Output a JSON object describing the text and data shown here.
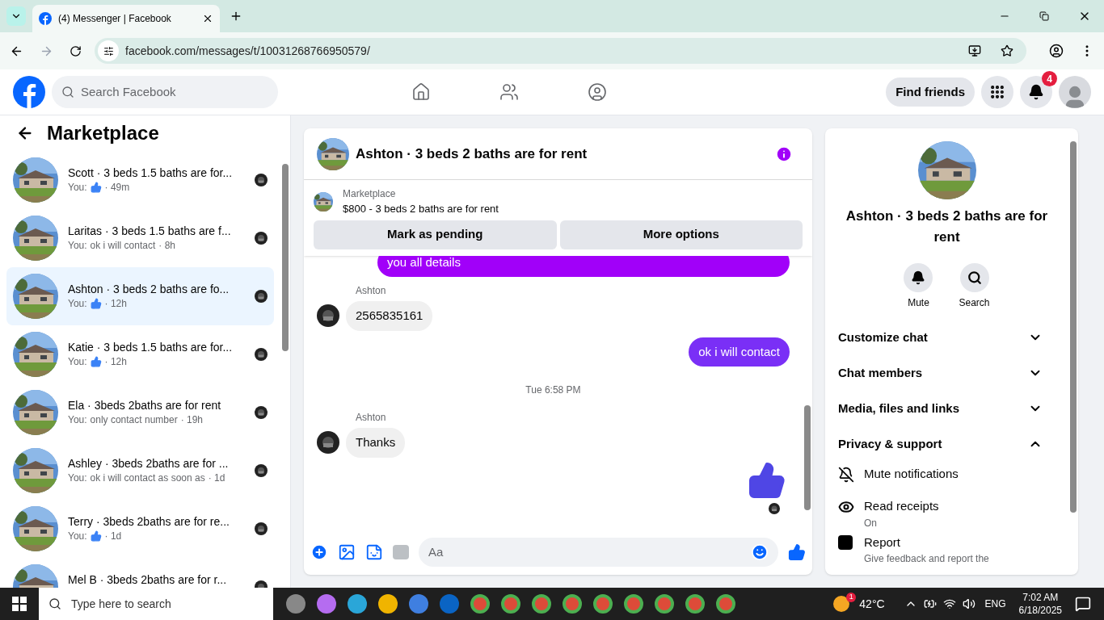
{
  "browser": {
    "tab_title": "(4) Messenger | Facebook",
    "url": "facebook.com/messages/t/10031268766950579/"
  },
  "topbar": {
    "search_placeholder": "Search Facebook",
    "find_friends": "Find friends",
    "notification_count": "4"
  },
  "sidebar": {
    "title": "Marketplace",
    "conversations": [
      {
        "title": "Scott · 3 beds 1.5 baths are for...",
        "sender": "You:",
        "like": true,
        "time": "· 49m",
        "selected": false
      },
      {
        "title": "Laritas · 3 beds 1.5 baths are f...",
        "sender": "You:",
        "like": false,
        "text": "ok i will contact",
        "time": "· 8h",
        "selected": false
      },
      {
        "title": "Ashton · 3 beds 2 baths are fo...",
        "sender": "You:",
        "like": true,
        "time": "· 12h",
        "selected": true
      },
      {
        "title": "Katie · 3 beds 1.5 baths are for...",
        "sender": "You:",
        "like": true,
        "time": "· 12h",
        "selected": false
      },
      {
        "title": "Ela · 3beds 2baths are for rent",
        "sender": "You:",
        "like": false,
        "text": "only contact number",
        "time": "· 19h",
        "selected": false
      },
      {
        "title": "Ashley · 3beds 2baths are for ...",
        "sender": "You:",
        "like": false,
        "text": "ok i will contact as soon as",
        "time": "· 1d",
        "selected": false
      },
      {
        "title": "Terry · 3beds 2baths are for re...",
        "sender": "You:",
        "like": true,
        "time": "· 1d",
        "selected": false
      },
      {
        "title": "Mel B · 3beds 2baths are for r...",
        "selected": false
      }
    ]
  },
  "chat": {
    "title": "Ashton · 3 beds 2 baths are for rent",
    "listing": {
      "source": "Marketplace",
      "summary": "$800 - 3 beds 2 baths are for rent",
      "buttons": [
        "Mark as pending",
        "More options"
      ]
    },
    "messages": [
      {
        "kind": "outgoing",
        "text": "you all details",
        "color": "#a100f9"
      },
      {
        "kind": "incoming",
        "sender": "Ashton",
        "text": "2565835161"
      },
      {
        "kind": "outgoing",
        "text": "ok i will contact",
        "color": "#7a2ff6"
      },
      {
        "kind": "timestamp",
        "text": "Tue 6:58 PM"
      },
      {
        "kind": "incoming",
        "sender": "Ashton",
        "text": "Thanks"
      },
      {
        "kind": "like"
      }
    ],
    "composer_placeholder": "Aa"
  },
  "details": {
    "title": "Ashton · 3 beds 2 baths are for rent",
    "actions": [
      "Mute",
      "Search"
    ],
    "sections": [
      {
        "label": "Customize chat",
        "expanded": false
      },
      {
        "label": "Chat members",
        "expanded": false
      },
      {
        "label": "Media, files and links",
        "expanded": false
      },
      {
        "label": "Privacy & support",
        "expanded": true
      }
    ],
    "privacy_items": [
      {
        "kind": "mute",
        "label": "Mute notifications"
      },
      {
        "kind": "receipts",
        "label": "Read receipts",
        "sub": "On"
      },
      {
        "kind": "report",
        "label": "Report",
        "sub": "Give feedback and report the"
      }
    ]
  },
  "taskbar": {
    "search_placeholder": "Type here to search",
    "weather_badge": "1",
    "temperature": "42°C",
    "language": "ENG",
    "time": "7:02 AM",
    "date": "6/18/2025"
  }
}
